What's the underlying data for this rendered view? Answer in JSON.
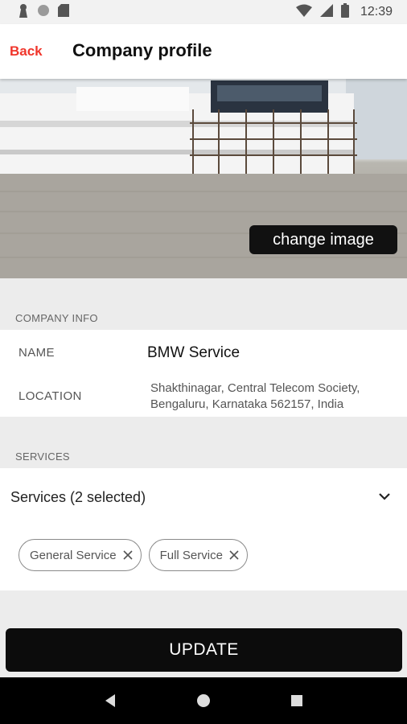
{
  "status_bar": {
    "time": "12:39",
    "icons": [
      "keyhole-icon",
      "circle-icon",
      "sd-card-icon",
      "wifi-icon",
      "signal-icon",
      "battery-icon"
    ]
  },
  "header": {
    "back_label": "Back",
    "title": "Company profile"
  },
  "hero": {
    "change_image_label": "change image"
  },
  "company_info": {
    "section_label": "COMPANY INFO",
    "name_label": "NAME",
    "name_value": "BMW Service",
    "location_label": "LOCATION",
    "location_value": "Shakthinagar, Central Telecom Society, Bengaluru, Karnataka 562157, India"
  },
  "services": {
    "section_label": "SERVICES",
    "select_label": "Services (2 selected)",
    "chips": [
      "General Service",
      "Full Service"
    ]
  },
  "footer": {
    "update_label": "UPDATE"
  },
  "colors": {
    "accent": "#f0352b",
    "button_bg": "#0c0c0c",
    "page_bg": "#ececec"
  }
}
